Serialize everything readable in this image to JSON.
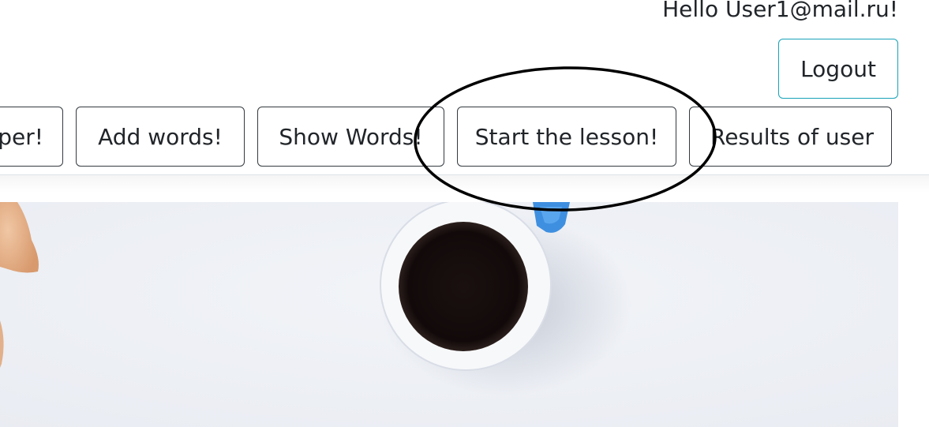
{
  "header": {
    "greeting": "Hello User1@mail.ru!",
    "logout_label": "Logout"
  },
  "nav": {
    "items": [
      {
        "label": "per!"
      },
      {
        "label": "Add words!"
      },
      {
        "label": "Show Words!"
      },
      {
        "label": "Start the lesson!"
      },
      {
        "label": "Results of user"
      }
    ]
  },
  "colors": {
    "logout_border": "#17a2b8",
    "nav_border": "#343a40",
    "annotation": "#000000",
    "hero_background": "#eef0f5"
  },
  "hero": {
    "image": "coffee-cup-photo"
  }
}
